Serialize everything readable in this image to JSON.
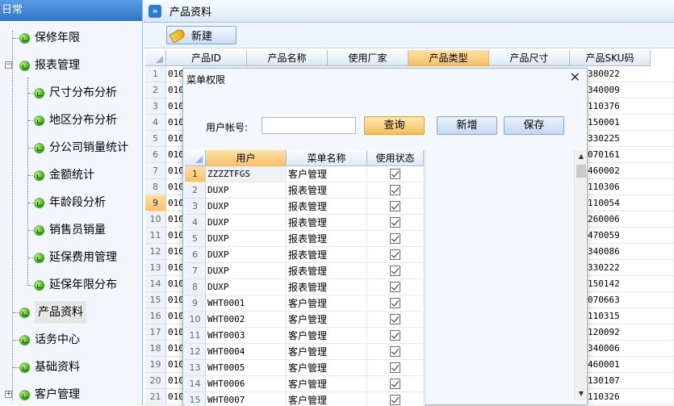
{
  "sidebar": {
    "header": "日常",
    "items": [
      {
        "label": "保修年限"
      },
      {
        "label": "报表管理"
      },
      {
        "label": "尺寸分布分析"
      },
      {
        "label": "地区分布分析"
      },
      {
        "label": "分公司销量统计"
      },
      {
        "label": "金额统计"
      },
      {
        "label": "年龄段分析"
      },
      {
        "label": "销售员销量"
      },
      {
        "label": "延保费用管理"
      },
      {
        "label": "延保年限分布"
      },
      {
        "label": "产品资料"
      },
      {
        "label": "话务中心"
      },
      {
        "label": "基础资料"
      },
      {
        "label": "客户管理"
      }
    ]
  },
  "tab": {
    "icon": "double-chevron-icon",
    "title": "产品资料"
  },
  "toolbar": {
    "new_label": "新建"
  },
  "grid": {
    "columns": [
      "产品ID",
      "产品名称",
      "使用厂家",
      "产品类型",
      "产品尺寸",
      "产品SKU码"
    ],
    "row_numbers": [
      "1",
      "2",
      "3",
      "4",
      "5",
      "6",
      "7",
      "8",
      "9",
      "10",
      "11",
      "12",
      "13",
      "14",
      "15",
      "16",
      "17",
      "18",
      "19",
      "20",
      "21"
    ],
    "id_prefix": [
      "010",
      "010",
      "010",
      "010",
      "010",
      "010",
      "010",
      "010",
      "010",
      "010",
      "010",
      "010",
      "010",
      "010",
      "010",
      "010",
      "010",
      "010",
      "010",
      "010",
      "010"
    ],
    "sku": [
      "380022",
      "340009",
      "110376",
      "150001",
      "330225",
      "070161",
      "460002",
      "110306",
      "110054",
      "260006",
      "470059",
      "340086",
      "330222",
      "150142",
      "070663",
      "110315",
      "120092",
      "340006",
      "460001",
      "130107",
      "110326"
    ]
  },
  "modal": {
    "title": "菜单权限",
    "close": "✕",
    "user_label": "用户帐号:",
    "user_value": "",
    "query_label": "查询",
    "add_label": "新增",
    "save_label": "保存",
    "columns": [
      "用户",
      "菜单名称",
      "使用状态"
    ],
    "rows": [
      {
        "n": "1",
        "user": "ZZZZTFGS",
        "menu": "客户管理"
      },
      {
        "n": "2",
        "user": "DUXP",
        "menu": "报表管理"
      },
      {
        "n": "3",
        "user": "DUXP",
        "menu": "报表管理"
      },
      {
        "n": "4",
        "user": "DUXP",
        "menu": "报表管理"
      },
      {
        "n": "5",
        "user": "DUXP",
        "menu": "报表管理"
      },
      {
        "n": "6",
        "user": "DUXP",
        "menu": "报表管理"
      },
      {
        "n": "7",
        "user": "DUXP",
        "menu": "报表管理"
      },
      {
        "n": "8",
        "user": "DUXP",
        "menu": "报表管理"
      },
      {
        "n": "9",
        "user": "WHT0001",
        "menu": "客户管理"
      },
      {
        "n": "10",
        "user": "WHT0002",
        "menu": "客户管理"
      },
      {
        "n": "11",
        "user": "WHT0003",
        "menu": "客户管理"
      },
      {
        "n": "12",
        "user": "WHT0004",
        "menu": "客户管理"
      },
      {
        "n": "13",
        "user": "WHT0005",
        "menu": "客户管理"
      },
      {
        "n": "14",
        "user": "WHT0006",
        "menu": "客户管理"
      },
      {
        "n": "15",
        "user": "WHT0007",
        "menu": "客户管理"
      }
    ]
  }
}
